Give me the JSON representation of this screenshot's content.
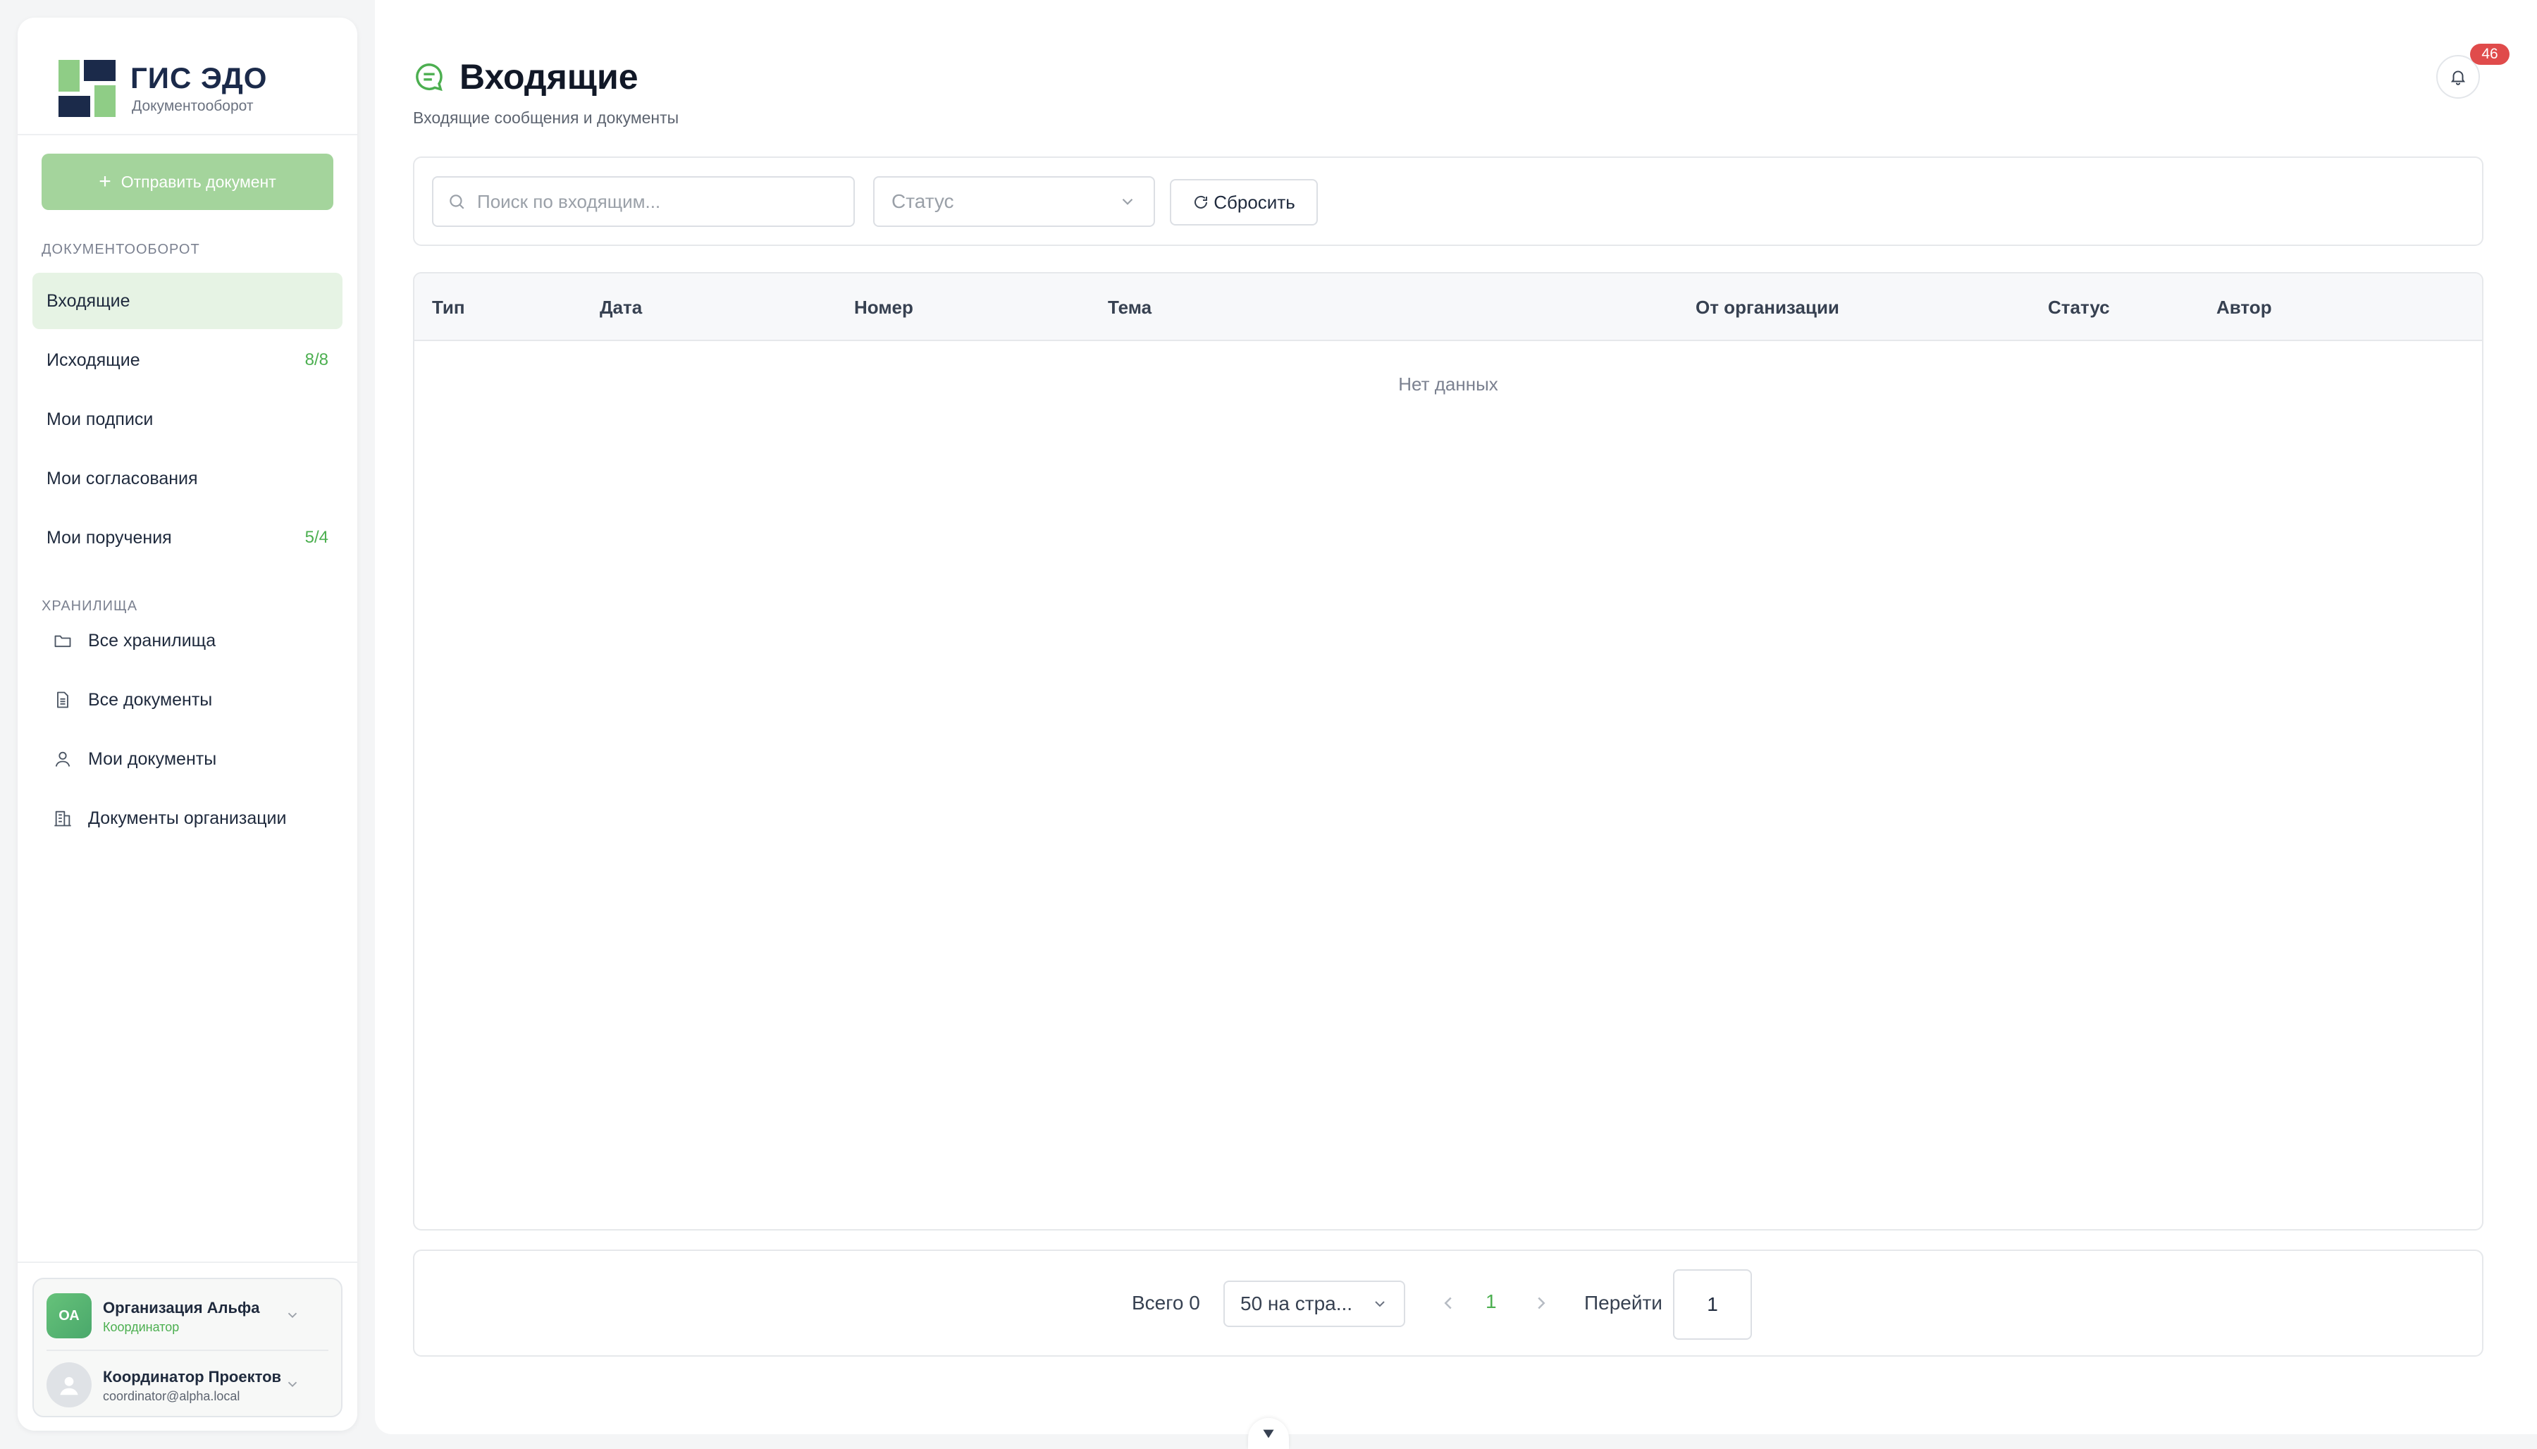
{
  "colors": {
    "accent_green": "#4caf50",
    "send_button": "#a4d49c",
    "active_nav": "#e6f3e4",
    "navy": "#1b2a4a",
    "badge_red": "#e04b4b"
  },
  "brand": {
    "title": "ГИС ЭДО",
    "subtitle": "Документооборот",
    "logo_icon": "brand-logo-icon"
  },
  "sidebar": {
    "send_button": {
      "icon": "plus-icon",
      "label": "Отправить документ"
    },
    "section_docflow": "ДОКУМЕНТООБОРОТ",
    "docflow_items": [
      {
        "label": "Входящие",
        "count": "",
        "active": true
      },
      {
        "label": "Исходящие",
        "count": "8/8"
      },
      {
        "label": "Мои подписи",
        "count": ""
      },
      {
        "label": "Мои согласования",
        "count": ""
      },
      {
        "label": "Мои поручения",
        "count": "5/4"
      }
    ],
    "section_storage": "ХРАНИЛИЩА",
    "storage_items": [
      {
        "label": "Все хранилища",
        "icon": "folder-icon"
      },
      {
        "label": "Все документы",
        "icon": "document-icon"
      },
      {
        "label": "Мои документы",
        "icon": "user-icon"
      },
      {
        "label": "Документы организации",
        "icon": "building-icon"
      }
    ],
    "org": {
      "initials": "ОА",
      "name": "Организация Альфа",
      "role": "Координатор"
    },
    "user": {
      "name": "Координатор Проектов",
      "email": "coordinator@alpha.local"
    }
  },
  "header": {
    "icon": "message-icon",
    "title": "Входящие",
    "subtitle": "Входящие сообщения и документы",
    "notifications_count": "46"
  },
  "filters": {
    "search_placeholder": "Поиск по входящим...",
    "search_value": "",
    "status_placeholder": "Статус",
    "reset_label": "Сбросить"
  },
  "table": {
    "columns": [
      "Тип",
      "Дата",
      "Номер",
      "Тема",
      "От организации",
      "Статус",
      "Автор"
    ],
    "rows": [],
    "empty_text": "Нет данных"
  },
  "pagination": {
    "total_label": "Всего 0",
    "per_page": "50 на стра...",
    "current_page": "1",
    "goto_label": "Перейти",
    "goto_value": "1"
  }
}
